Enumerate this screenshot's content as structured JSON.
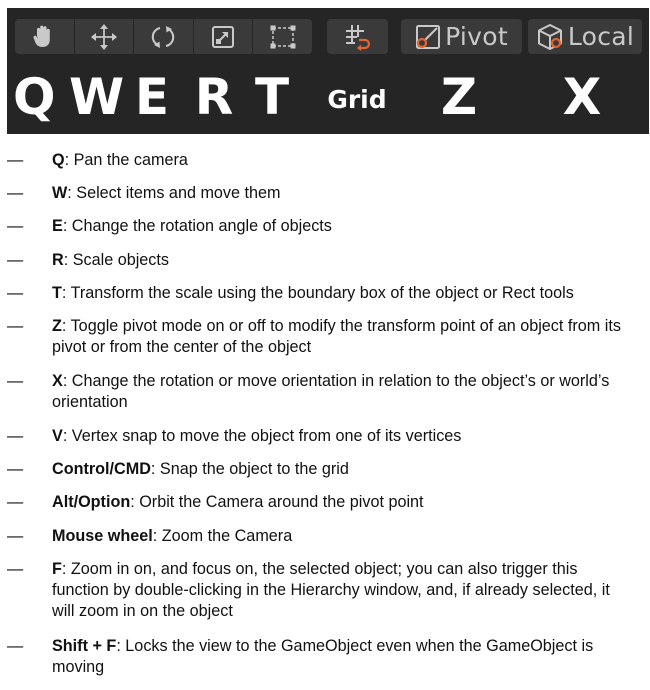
{
  "toolbar": {
    "tools": [
      {
        "name": "hand-icon"
      },
      {
        "name": "move-icon"
      },
      {
        "name": "rotate-icon"
      },
      {
        "name": "scale-icon"
      },
      {
        "name": "rect-tool-icon"
      }
    ],
    "grid_icon": "grid-snap-icon",
    "pivot_label": "Pivot",
    "local_label": "Local",
    "icon_color": "#c9c9c9",
    "accent_color": "#e2642e",
    "key_labels": [
      "Q",
      "W",
      "E",
      "R",
      "T",
      "Grid",
      "Z",
      "X"
    ]
  },
  "shortcuts": [
    {
      "dash": "—",
      "key": "Q",
      "desc": ": Pan the camera"
    },
    {
      "dash": "—",
      "key": "W",
      "desc": ": Select items and move them"
    },
    {
      "dash": "—",
      "key": "E",
      "desc": ": Change the rotation angle of objects"
    },
    {
      "dash": "—",
      "key": "R",
      "desc": ": Scale objects"
    },
    {
      "dash": "—",
      "key": "T",
      "desc": ": Transform the scale using the boundary box of the object or Rect tools"
    },
    {
      "dash": "—",
      "key": "Z",
      "desc": ": Toggle pivot mode on or off to modify the transform point of an object from its pivot or from the center of the object"
    },
    {
      "dash": "—",
      "key": "X",
      "desc": ": Change the rotation or move orientation in relation to the object’s or world’s orientation"
    },
    {
      "dash": "—",
      "key": "V",
      "desc": ": Vertex snap to move the object from one of its vertices"
    },
    {
      "dash": "—",
      "key": "Control/CMD",
      "desc": ": Snap the object to the grid"
    },
    {
      "dash": "—",
      "key": "Alt/Option",
      "desc": ": Orbit the Camera around the pivot point"
    },
    {
      "dash": "—",
      "key": "Mouse wheel",
      "desc": ": Zoom the Camera"
    },
    {
      "dash": "—",
      "key": "F",
      "desc": ": Zoom in on, and focus on, the selected object; you can also trigger this function by double-clicking in the Hierarchy window, and, if already selected, it will zoom in on the object"
    },
    {
      "dash": "—",
      "key": "Shift + F",
      "desc": ": Locks the view to the GameObject even when the GameObject is moving"
    }
  ]
}
